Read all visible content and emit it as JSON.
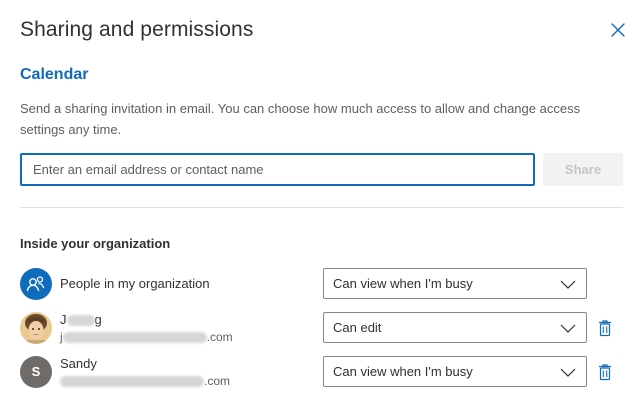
{
  "dialog": {
    "title": "Sharing and permissions",
    "close_icon": "close-icon"
  },
  "calendar": {
    "name": "Calendar",
    "description": "Send a sharing invitation in email. You can choose how much access to allow and change access settings any time."
  },
  "invite": {
    "placeholder": "Enter an email address or contact name",
    "value": "",
    "share_label": "Share",
    "share_enabled": false
  },
  "inside_org": {
    "title": "Inside your organization",
    "members": [
      {
        "name": "People in my organization",
        "email": "",
        "avatar": "people-icon",
        "permission": "Can view when I'm busy",
        "deletable": false
      },
      {
        "name_start": "J",
        "name_end": "g",
        "email_start": "j",
        "email_end": ".com",
        "avatar": "photo",
        "permission": "Can edit",
        "deletable": true
      },
      {
        "name": "Sandy",
        "initial": "S",
        "email_end": ".com",
        "avatar": "initial",
        "permission": "Can view when I'm busy",
        "deletable": true
      }
    ]
  },
  "colors": {
    "accent": "#0f6cbd",
    "text": "#323130",
    "secondary_text": "#605e5c",
    "disabled_bg": "#f3f2f1",
    "disabled_text": "#c8c6c4"
  }
}
